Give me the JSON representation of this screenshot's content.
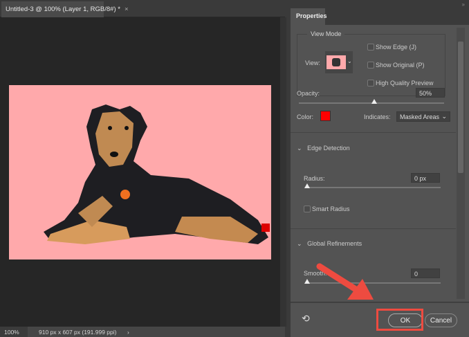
{
  "document": {
    "tab_title": "Untitled-3 @ 100% (Layer 1, RGB/8#) *",
    "close_icon": "×"
  },
  "status": {
    "zoom": "100%",
    "dimensions": "910 px x 607 px (191.999 ppi)",
    "arrow": "›"
  },
  "panel": {
    "tab": "Properties",
    "collapse": "»",
    "view_mode": {
      "legend": "View Mode",
      "view_label": "View:",
      "show_edge": "Show Edge (J)",
      "show_original": "Show Original (P)",
      "high_quality": "High Quality Preview"
    },
    "opacity": {
      "label": "Opacity:",
      "value": "50%",
      "slider_percent": 50
    },
    "color": {
      "label": "Color:",
      "swatch": "#ff0000"
    },
    "indicates": {
      "label": "Indicates:",
      "value": "Masked Areas"
    },
    "edge_detection": {
      "title": "Edge Detection",
      "radius_label": "Radius:",
      "radius_value": "0 px",
      "smart_radius": "Smart Radius"
    },
    "global_refinements": {
      "title": "Global Refinements",
      "smooth_label": "Smooth:",
      "smooth_value": "0"
    },
    "ok": "OK",
    "cancel": "Cancel"
  },
  "colors": {
    "overlay": "#ffa9ab",
    "highlight": "#ee4b40"
  }
}
